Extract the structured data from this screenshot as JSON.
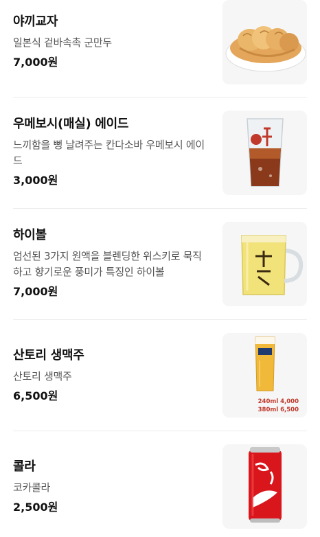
{
  "items": [
    {
      "name": "야끼교자",
      "desc": "일본식 겉바속촉 군만두",
      "price": "7,000원",
      "image_icon": "dumpling-plate-icon"
    },
    {
      "name": "우메보시(매실) 에이드",
      "desc": "느끼함을 뻥 날려주는 칸다소바 우메보시 에이드",
      "price": "3,000원",
      "image_icon": "ade-glass-icon"
    },
    {
      "name": "하이볼",
      "desc": "엄선된 3가지 원액을 블렌딩한 위스키로 묵직하고 향기로운 풍미가 특징인 하이볼",
      "price": "7,000원",
      "image_icon": "highball-mug-icon"
    },
    {
      "name": "산토리 생맥주",
      "desc": "산토리 생맥주",
      "price": "6,500원",
      "image_icon": "beer-glass-icon",
      "image_text": [
        "240ml 4,000",
        "380ml 6,500"
      ]
    },
    {
      "name": "콜라",
      "desc": "코카콜라",
      "price": "2,500원",
      "image_icon": "cola-can-icon"
    }
  ],
  "colors": {
    "accent_red": "#c0392b",
    "text": "#111111",
    "subtext": "#555555",
    "divider": "#ececec"
  }
}
